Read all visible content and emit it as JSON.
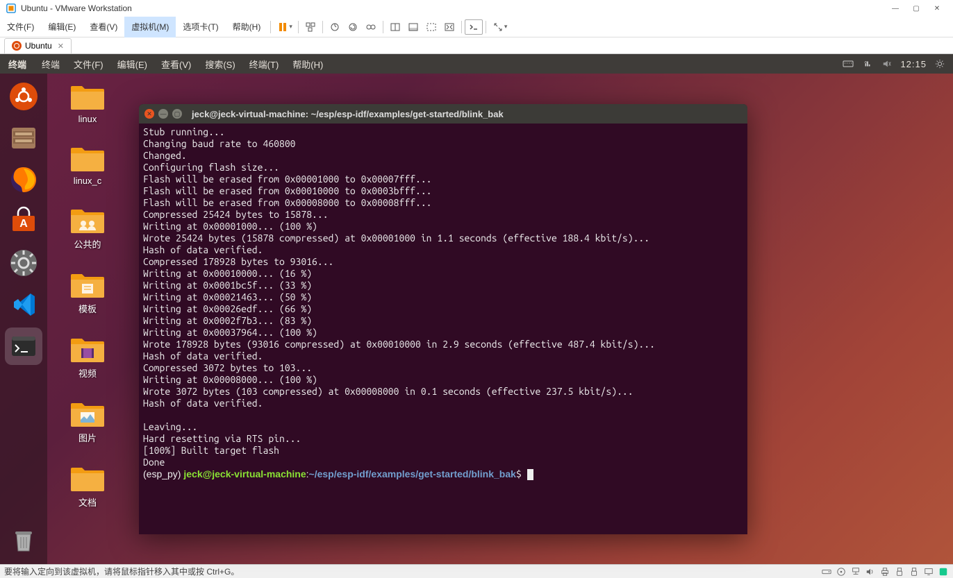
{
  "vmware": {
    "title": "Ubuntu - VMware Workstation",
    "menu": [
      "文件(F)",
      "编辑(E)",
      "查看(V)",
      "虚拟机(M)",
      "选项卡(T)",
      "帮助(H)"
    ],
    "active_menu_index": 3,
    "tab": {
      "label": "Ubuntu"
    },
    "statusbar": "要将输入定向到该虚拟机，请将鼠标指针移入其中或按 Ctrl+G。"
  },
  "ubuntu": {
    "panel_title": "终端",
    "panel_menu": [
      "终端",
      "文件(F)",
      "编辑(E)",
      "查看(V)",
      "搜索(S)",
      "终端(T)",
      "帮助(H)"
    ],
    "time": "12:15",
    "desktop_icons": [
      "linux",
      "linux_c",
      "公共的",
      "模板",
      "视频",
      "图片",
      "文档"
    ]
  },
  "terminal": {
    "title": "jeck@jeck-virtual-machine: ~/esp/esp-idf/examples/get-started/blink_bak",
    "lines": [
      "Stub running...",
      "Changing baud rate to 460800",
      "Changed.",
      "Configuring flash size...",
      "Flash will be erased from 0x00001000 to 0x00007fff...",
      "Flash will be erased from 0x00010000 to 0x0003bfff...",
      "Flash will be erased from 0x00008000 to 0x00008fff...",
      "Compressed 25424 bytes to 15878...",
      "Writing at 0x00001000... (100 %)",
      "Wrote 25424 bytes (15878 compressed) at 0x00001000 in 1.1 seconds (effective 188.4 kbit/s)...",
      "Hash of data verified.",
      "Compressed 178928 bytes to 93016...",
      "Writing at 0x00010000... (16 %)",
      "Writing at 0x0001bc5f... (33 %)",
      "Writing at 0x00021463... (50 %)",
      "Writing at 0x00026edf... (66 %)",
      "Writing at 0x0002f7b3... (83 %)",
      "Writing at 0x00037964... (100 %)",
      "Wrote 178928 bytes (93016 compressed) at 0x00010000 in 2.9 seconds (effective 487.4 kbit/s)...",
      "Hash of data verified.",
      "Compressed 3072 bytes to 103...",
      "Writing at 0x00008000... (100 %)",
      "Wrote 3072 bytes (103 compressed) at 0x00008000 in 0.1 seconds (effective 237.5 kbit/s)...",
      "Hash of data verified.",
      "",
      "Leaving...",
      "Hard resetting via RTS pin...",
      "[100%] Built target flash",
      "Done"
    ],
    "prompt": {
      "env": "(esp_py) ",
      "user": "jeck@jeck-virtual-machine",
      "sep": ":",
      "path": "~/esp/esp-idf/examples/get-started/blink_bak",
      "end": "$"
    }
  }
}
